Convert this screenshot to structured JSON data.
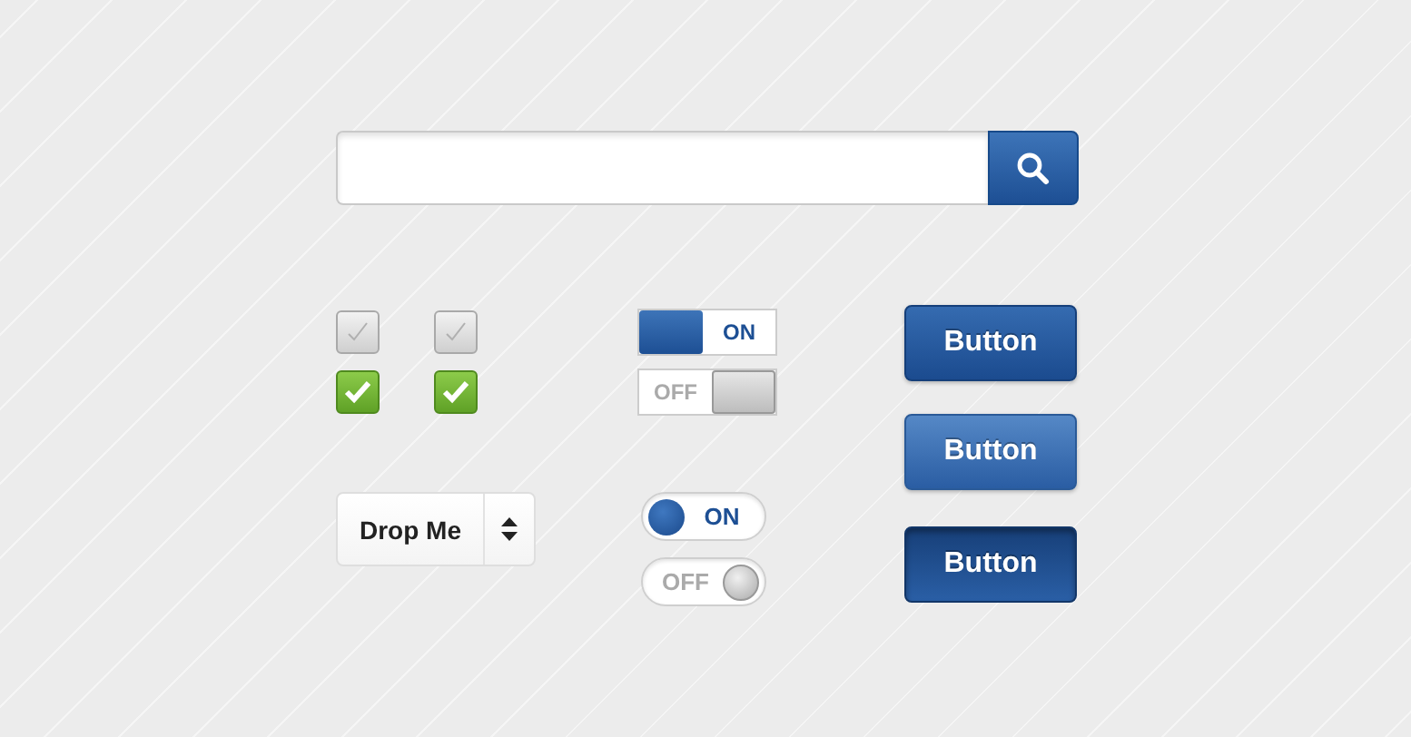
{
  "search": {
    "kind": "search"
  },
  "checkboxes": [
    {
      "checked": false
    },
    {
      "checked": false
    },
    {
      "checked": true
    },
    {
      "checked": true
    }
  ],
  "square_switches": [
    {
      "on": true,
      "label": "ON"
    },
    {
      "on": false,
      "label": "OFF"
    }
  ],
  "round_switches": [
    {
      "on": true,
      "label": "ON"
    },
    {
      "on": false,
      "label": "OFF"
    }
  ],
  "dropdown": {
    "value": "Drop Me"
  },
  "buttons": [
    {
      "label": "Button",
      "kind": "normal"
    },
    {
      "label": "Button",
      "kind": "hover"
    },
    {
      "label": "Button",
      "kind": "pressed"
    }
  ]
}
